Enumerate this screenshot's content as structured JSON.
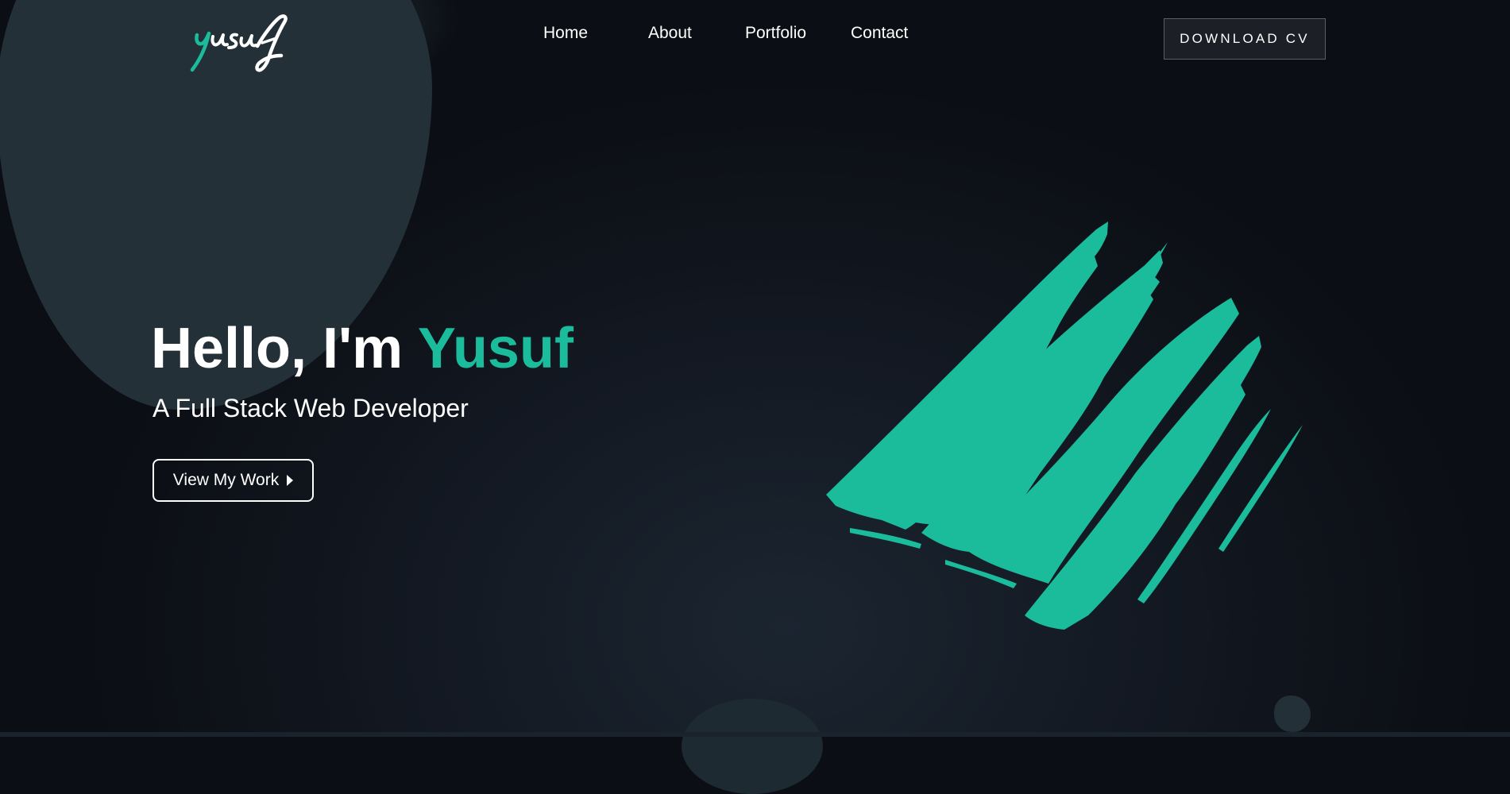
{
  "logo": {
    "text": "yusuf",
    "accent_color": "#1abc9c"
  },
  "nav": {
    "items": [
      "Home",
      "About",
      "Portfolio",
      "Contact"
    ]
  },
  "header": {
    "download_label": "DOWNLOAD CV"
  },
  "hero": {
    "greeting": "Hello, I'm",
    "name": "Yusuf",
    "subtitle": "A Full Stack Web Developer",
    "cta_label": "View My Work",
    "cta_icon": "caret-right-icon"
  },
  "colors": {
    "accent": "#1abc9c",
    "background": "#12161d",
    "blob": "#243038"
  }
}
